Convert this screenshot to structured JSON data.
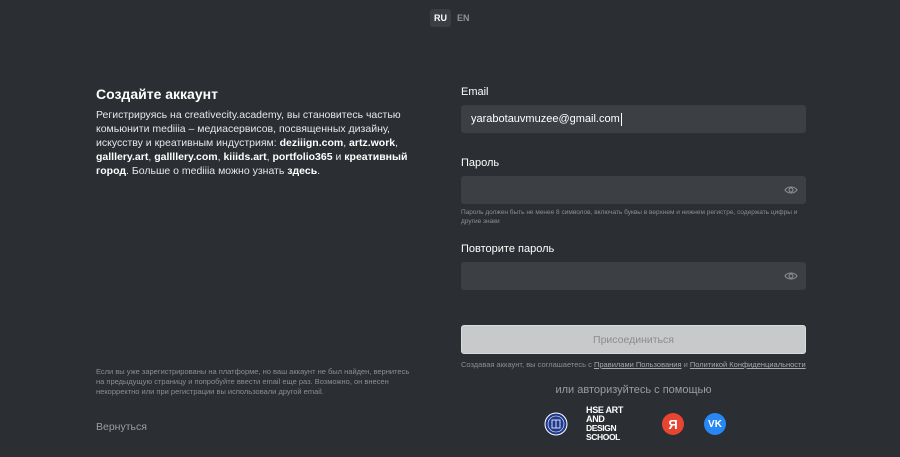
{
  "lang": {
    "ru": "RU",
    "en": "EN"
  },
  "left": {
    "title": "Создайте аккаунт",
    "desc_1": "Регистрируясь на creativecity.academy, вы становитесь частью комьюнити mediiia – медиасервисов, посвященных дизайну, искусству и креативным индустриям: ",
    "link_deziign": "deziiign.com",
    "link_artz": "artz.work",
    "link_galllery_art": "galllery.art",
    "link_galllery_com": "gallllery.com",
    "link_kiiids": "kiiids.art",
    "link_portfolio": "portfolio365",
    "and": " и ",
    "link_creative": "креативный город",
    "desc_2": ". Больше о mediiia можно узнать ",
    "link_here": "здесь",
    "note": "Если вы уже зарегистрированы на платформе, но ваш аккаунт не был найден, вернитесь на предыдущую страницу и попробуйте ввести email еще раз. Возможно, он внесен некорректно или при регистрации вы использовали другой email.",
    "back": "Вернуться"
  },
  "form": {
    "email_label": "Email",
    "email_value": "yarabotauvmuzee@gmail.com",
    "password_label": "Пароль",
    "password_hint": "Пароль должен быть не менее 8 символов, включать буквы в верхнем и нижнем регистре, содержать цифры и другие знаки",
    "repeat_label": "Повторите пароль",
    "submit": "Присоединиться",
    "terms_prefix": "Создавая аккаунт, вы соглашаетесь с ",
    "terms_link": "Правилами Пользования",
    "terms_and": " и ",
    "privacy_link": "Политикой Конфиденциальности"
  },
  "oauth": {
    "label": "или авторизуйтесь с помощью",
    "hse_art_line1": "HSE ART AND",
    "hse_art_line2": "DESIGN SCHOOL",
    "yandex": "Я",
    "vk": "VK"
  },
  "colors": {
    "background": "#2b2e32",
    "input": "#3c4045",
    "yandex": "#e84432",
    "vk": "#2787f5"
  }
}
